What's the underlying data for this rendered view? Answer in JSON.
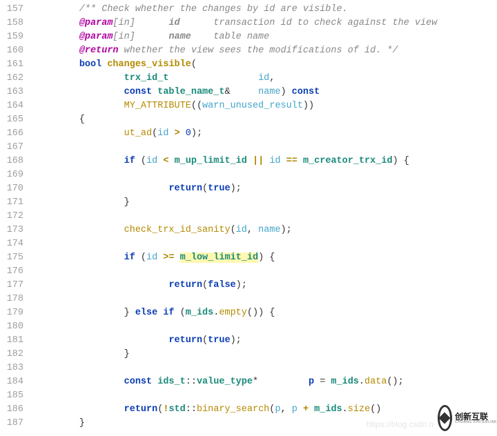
{
  "line_start": 157,
  "line_end": 187,
  "lines": {
    "157": [
      [
        "cm",
        "        /** Check whether the changes by id are visible."
      ]
    ],
    "158": [
      [
        "pl",
        "        "
      ],
      [
        "cmt",
        "@param"
      ],
      [
        "cm",
        "[in]      "
      ],
      [
        "cmb",
        "id"
      ],
      [
        "cm",
        "      transaction id to check against the view"
      ]
    ],
    "159": [
      [
        "pl",
        "        "
      ],
      [
        "cmt",
        "@param"
      ],
      [
        "cm",
        "[in]      "
      ],
      [
        "cmb",
        "name"
      ],
      [
        "cm",
        "    table name"
      ]
    ],
    "160": [
      [
        "pl",
        "        "
      ],
      [
        "cmt",
        "@return"
      ],
      [
        "cm",
        " whether the view sees the modifications of id. */"
      ]
    ],
    "161": [
      [
        "pl",
        "        "
      ],
      [
        "kw",
        "bool "
      ],
      [
        "fnb",
        "changes_visible"
      ],
      [
        "pl",
        "("
      ]
    ],
    "162": [
      [
        "pl",
        "                "
      ],
      [
        "ty",
        "trx_id_t"
      ],
      [
        "pl",
        "                "
      ],
      [
        "id",
        "id"
      ],
      [
        "pl",
        ","
      ]
    ],
    "163": [
      [
        "pl",
        "                "
      ],
      [
        "kw",
        "const "
      ],
      [
        "ty",
        "table_name_t"
      ],
      [
        "pl",
        "&     "
      ],
      [
        "id",
        "name"
      ],
      [
        "pl",
        ") "
      ],
      [
        "kw",
        "const"
      ]
    ],
    "164": [
      [
        "pl",
        "                "
      ],
      [
        "fn",
        "MY_ATTRIBUTE"
      ],
      [
        "pl",
        "(("
      ],
      [
        "id",
        "warn_unused_result"
      ],
      [
        "pl",
        "))"
      ]
    ],
    "165": [
      [
        "pl",
        "        {"
      ]
    ],
    "166": [
      [
        "pl",
        "                "
      ],
      [
        "fn",
        "ut_ad"
      ],
      [
        "pl",
        "("
      ],
      [
        "id",
        "id"
      ],
      [
        "pl",
        " "
      ],
      [
        "op",
        ">"
      ],
      [
        "pl",
        " "
      ],
      [
        "num",
        "0"
      ],
      [
        "pl",
        ");"
      ]
    ],
    "167": [
      [
        "pl",
        " "
      ]
    ],
    "168": [
      [
        "pl",
        "                "
      ],
      [
        "kw",
        "if"
      ],
      [
        "pl",
        " ("
      ],
      [
        "id",
        "id"
      ],
      [
        "pl",
        " "
      ],
      [
        "op",
        "<"
      ],
      [
        "pl",
        " "
      ],
      [
        "ty",
        "m_up_limit_id"
      ],
      [
        "pl",
        " "
      ],
      [
        "op",
        "||"
      ],
      [
        "pl",
        " "
      ],
      [
        "id",
        "id"
      ],
      [
        "pl",
        " "
      ],
      [
        "op",
        "=="
      ],
      [
        "pl",
        " "
      ],
      [
        "ty",
        "m_creator_trx_id"
      ],
      [
        "pl",
        ") {"
      ]
    ],
    "169": [
      [
        "pl",
        " "
      ]
    ],
    "170": [
      [
        "pl",
        "                        "
      ],
      [
        "kw",
        "return"
      ],
      [
        "pl",
        "("
      ],
      [
        "kw",
        "true"
      ],
      [
        "pl",
        ");"
      ]
    ],
    "171": [
      [
        "pl",
        "                }"
      ]
    ],
    "172": [
      [
        "pl",
        " "
      ]
    ],
    "173": [
      [
        "pl",
        "                "
      ],
      [
        "fn",
        "check_trx_id_sanity"
      ],
      [
        "pl",
        "("
      ],
      [
        "id",
        "id"
      ],
      [
        "pl",
        ", "
      ],
      [
        "id",
        "name"
      ],
      [
        "pl",
        ");"
      ]
    ],
    "174": [
      [
        "pl",
        " "
      ]
    ],
    "175": [
      [
        "pl",
        "                "
      ],
      [
        "kw",
        "if"
      ],
      [
        "pl",
        " ("
      ],
      [
        "id",
        "id"
      ],
      [
        "pl",
        " "
      ],
      [
        "op",
        ">="
      ],
      [
        "pl",
        " "
      ],
      [
        "hl",
        "m_low_limit_id"
      ],
      [
        "pl",
        ") {"
      ]
    ],
    "176": [
      [
        "pl",
        " "
      ]
    ],
    "177": [
      [
        "pl",
        "                        "
      ],
      [
        "kw",
        "return"
      ],
      [
        "pl",
        "("
      ],
      [
        "kw",
        "false"
      ],
      [
        "pl",
        ");"
      ]
    ],
    "178": [
      [
        "pl",
        " "
      ]
    ],
    "179": [
      [
        "pl",
        "                } "
      ],
      [
        "kw",
        "else if"
      ],
      [
        "pl",
        " ("
      ],
      [
        "ty",
        "m_ids"
      ],
      [
        "pl",
        "."
      ],
      [
        "fn",
        "empty"
      ],
      [
        "pl",
        "()) {"
      ]
    ],
    "180": [
      [
        "pl",
        " "
      ]
    ],
    "181": [
      [
        "pl",
        "                        "
      ],
      [
        "kw",
        "return"
      ],
      [
        "pl",
        "("
      ],
      [
        "kw",
        "true"
      ],
      [
        "pl",
        ");"
      ]
    ],
    "182": [
      [
        "pl",
        "                }"
      ]
    ],
    "183": [
      [
        "pl",
        " "
      ]
    ],
    "184": [
      [
        "pl",
        "                "
      ],
      [
        "kw",
        "const "
      ],
      [
        "ty",
        "ids_t"
      ],
      [
        "pl",
        "::"
      ],
      [
        "ty",
        "value_type"
      ],
      [
        "pl",
        "*         "
      ],
      [
        "kw",
        "p"
      ],
      [
        "pl",
        " = "
      ],
      [
        "ty",
        "m_ids"
      ],
      [
        "pl",
        "."
      ],
      [
        "fn",
        "data"
      ],
      [
        "pl",
        "();"
      ]
    ],
    "185": [
      [
        "pl",
        " "
      ]
    ],
    "186": [
      [
        "pl",
        "                "
      ],
      [
        "kw",
        "return"
      ],
      [
        "pl",
        "("
      ],
      [
        "op",
        "!"
      ],
      [
        "ty",
        "std"
      ],
      [
        "pl",
        "::"
      ],
      [
        "fn",
        "binary_search"
      ],
      [
        "pl",
        "("
      ],
      [
        "id",
        "p"
      ],
      [
        "pl",
        ", "
      ],
      [
        "id",
        "p"
      ],
      [
        "pl",
        " "
      ],
      [
        "op",
        "+"
      ],
      [
        "pl",
        " "
      ],
      [
        "ty",
        "m_ids"
      ],
      [
        "pl",
        "."
      ],
      [
        "fn",
        "size"
      ],
      [
        "pl",
        "()"
      ]
    ],
    "187": [
      [
        "pl",
        "        }"
      ]
    ]
  },
  "watermark": {
    "url": "https://blog.csdn.n",
    "brand_cn": "创新互联",
    "brand_en": "CHUANG XINTERLINK"
  }
}
